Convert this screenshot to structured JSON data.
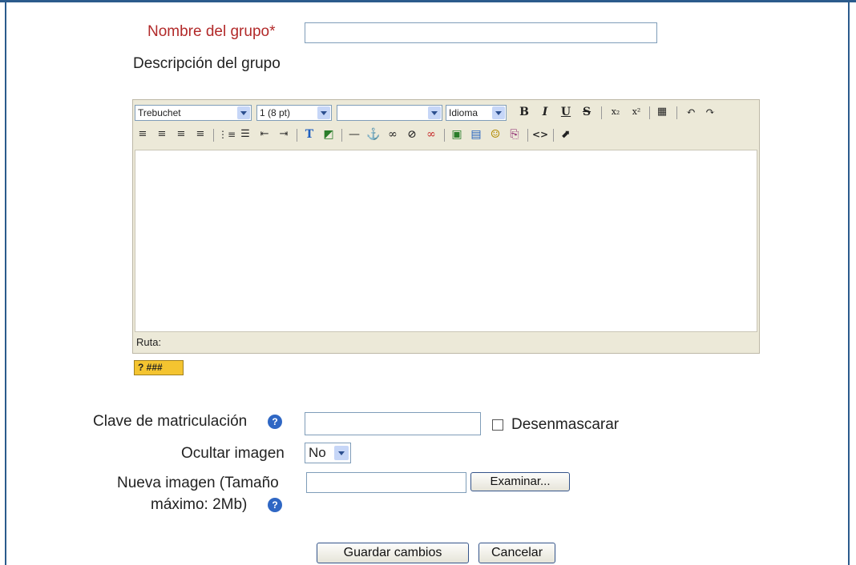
{
  "group_name": {
    "label": "Nombre del grupo*",
    "value": ""
  },
  "description": {
    "label": "Descripción del grupo"
  },
  "editor": {
    "font_select": "Trebuchet",
    "size_select": "1 (8 pt)",
    "style_select": "",
    "language_select": "Idioma",
    "row1_buttons": [
      "B",
      "I",
      "U",
      "S",
      "x₂",
      "x²",
      "▦",
      "↶",
      "↷"
    ],
    "row2_buttons": [
      "≡",
      "≡",
      "≡",
      "≡",
      "⋮≡",
      "☰",
      "⇤",
      "⇥",
      "T",
      "◩",
      "—",
      "⚓",
      "∞",
      "⊘",
      "∞",
      "▣",
      "▤",
      "☺",
      "⎘",
      "<>",
      "⬈"
    ],
    "status_label": "Ruta:",
    "help_badge": "? ###"
  },
  "enrolment_key": {
    "label": "Clave de matriculación",
    "value": "",
    "unmask_label": "Desenmascarar",
    "unmask_checked": false
  },
  "hide_picture": {
    "label": "Ocultar imagen",
    "value": "No"
  },
  "new_picture": {
    "label_line1": "Nueva imagen (Tamaño",
    "label_line2": "máximo: 2Mb)",
    "value": "",
    "browse_label": "Examinar..."
  },
  "actions": {
    "save_label": "Guardar cambios",
    "cancel_label": "Cancelar"
  },
  "colors": {
    "frame": "#2b5b8c",
    "required_label": "#b22a2a",
    "help_icon": "#2f67c4",
    "toolbar_bg": "#ece9d8"
  }
}
